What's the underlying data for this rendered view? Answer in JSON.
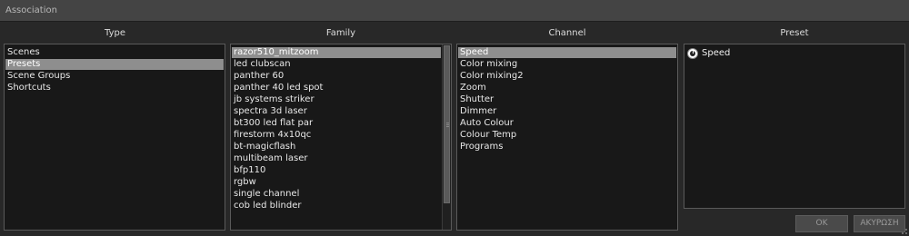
{
  "window": {
    "title": "Association"
  },
  "columns": {
    "type": {
      "header": "Type",
      "items": [
        "Scenes",
        "Presets",
        "Scene Groups",
        "Shortcuts"
      ],
      "selected_index": 1
    },
    "family": {
      "header": "Family",
      "items": [
        "razor510_mitzoom",
        "led clubscan",
        "panther 60",
        "panther 40 led spot",
        "jb systems striker",
        "spectra 3d laser",
        "bt300 led flat par",
        "firestorm 4x10qc",
        "bt-magicflash",
        "multibeam laser",
        "bfp110",
        "rgbw",
        "single channel",
        "cob led blinder"
      ],
      "selected_index": 0
    },
    "channel": {
      "header": "Channel",
      "items": [
        "Speed",
        "Color mixing",
        "Color mixing2",
        "Zoom",
        "Shutter",
        "Dimmer",
        "Auto Colour",
        "Colour Temp",
        "Programs"
      ],
      "selected_index": 0
    },
    "preset": {
      "header": "Preset",
      "items": [
        {
          "label": "Speed",
          "icon": "speed-dial-icon"
        }
      ]
    }
  },
  "buttons": {
    "ok_label": "OK",
    "cancel_label": "ΑΚΥΡΩΣΗ"
  },
  "colors": {
    "selection": "#8e8e8e",
    "panel_bg": "#181818",
    "window_bg": "#282828"
  }
}
